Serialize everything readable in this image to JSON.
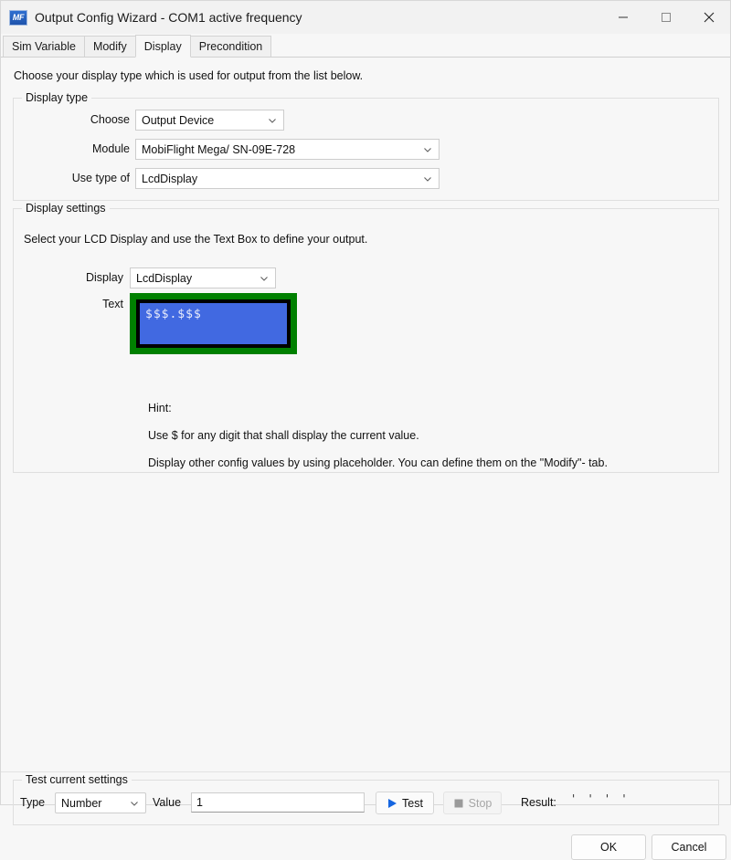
{
  "window": {
    "title": "Output Config Wizard - COM1 active frequency",
    "app_icon": "mobiflight-logo-icon",
    "controls": {
      "minimize": "minimize-icon",
      "maximize": "maximize-icon",
      "close": "close-icon"
    }
  },
  "tabs": [
    {
      "label": "Sim Variable",
      "active": false
    },
    {
      "label": "Modify",
      "active": false
    },
    {
      "label": "Display",
      "active": true
    },
    {
      "label": "Precondition",
      "active": false
    }
  ],
  "main": {
    "intro": "Choose your display type which is used for output from the list below.",
    "display_type": {
      "group_title": "Display type",
      "choose_label": "Choose",
      "choose_value": "Output Device",
      "module_label": "Module",
      "module_value": "MobiFlight Mega/ SN-09E-728",
      "use_type_label": "Use type of",
      "use_type_value": "LcdDisplay"
    },
    "display_settings": {
      "group_title": "Display settings",
      "description": "Select your LCD Display and use the Text Box to define your output.",
      "display_label": "Display",
      "display_value": "LcdDisplay",
      "text_label": "Text",
      "lcd_text": "$$$.$$$",
      "lcd_colors": {
        "bezel": "#008000",
        "frame": "#000000",
        "screen": "#4169e1",
        "text": "#e8ecfb"
      },
      "hint_title": "Hint:",
      "hint_line_1": "Use $ for any digit that shall display the current value.",
      "hint_line_2": "Display other config values by using placeholder. You can define them on the \"Modify\"- tab."
    }
  },
  "test_bar": {
    "group_title": "Test current settings",
    "type_label": "Type",
    "type_value": "Number",
    "value_label": "Value",
    "value_value": "1",
    "test_label": "Test",
    "test_icon": "play-icon",
    "stop_label": "Stop",
    "stop_icon": "stop-icon",
    "stop_disabled": true,
    "result_label": "Result:",
    "result_value": "' ' ' '"
  },
  "dialog_buttons": {
    "ok": "OK",
    "cancel": "Cancel"
  }
}
